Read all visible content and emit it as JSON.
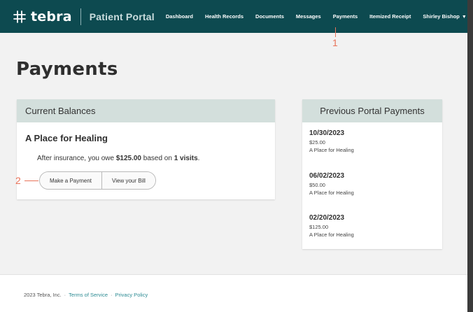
{
  "app": {
    "logo_text": "tebra",
    "portal_title": "Patient Portal"
  },
  "nav": {
    "items": [
      "Dashboard",
      "Health Records",
      "Documents",
      "Messages",
      "Payments",
      "Itemized Receipt"
    ],
    "user_name": "Shirley Bishop"
  },
  "annotations": {
    "marker_1": "1",
    "marker_2": "2"
  },
  "page": {
    "title": "Payments"
  },
  "current_balances": {
    "header": "Current Balances",
    "practice": "A Place for Healing",
    "owe_prefix": "After insurance, you owe ",
    "owe_amount": "$125.00",
    "owe_middle": " based on ",
    "visits": "1 visits",
    "owe_suffix": ".",
    "make_payment_label": "Make a Payment",
    "view_bill_label": "View your Bill"
  },
  "previous_payments": {
    "header": "Previous Portal Payments",
    "items": [
      {
        "date": "10/30/2023",
        "amount": "$25.00",
        "place": "A Place for Healing"
      },
      {
        "date": "06/02/2023",
        "amount": "$50.00",
        "place": "A Place for Healing"
      },
      {
        "date": "02/20/2023",
        "amount": "$125.00",
        "place": "A Place for Healing"
      }
    ]
  },
  "footer": {
    "copyright": "2023 Tebra, Inc.",
    "separator": "·",
    "terms_label": "Terms of Service",
    "privacy_label": "Privacy Policy"
  },
  "colors": {
    "nav_bg": "#0d4a50",
    "card_header_bg": "#d3dfdc",
    "annotation": "#e8735a",
    "link": "#2c8b93"
  }
}
